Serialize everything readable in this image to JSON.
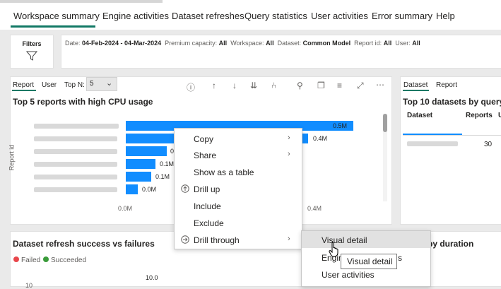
{
  "nav": {
    "tabs": [
      "Workspace summary",
      "Engine activities",
      "Dataset refreshes",
      "Query statistics",
      "User activities",
      "Error summary",
      "Help"
    ]
  },
  "filters": {
    "label": "Filters",
    "items": [
      {
        "key": "Date:",
        "value": "04-Feb-2024 - 04-Mar-2024"
      },
      {
        "key": "Premium capacity:",
        "value": "All"
      },
      {
        "key": "Workspace:",
        "value": "All"
      },
      {
        "key": "Dataset:",
        "value": "Common Model"
      },
      {
        "key": "Report id:",
        "value": "All"
      },
      {
        "key": "User:",
        "value": "All"
      }
    ]
  },
  "left_visual": {
    "subtabs": [
      "Report",
      "User"
    ],
    "topn_label": "Top N:",
    "topn_value": "5",
    "title": "Top 5 reports with high CPU usage",
    "y_axis_label": "Report id",
    "x_ticks": [
      "0.0M",
      "0.4M"
    ],
    "bar_labels": [
      "0.5M",
      "0.4M",
      "0",
      "0.1M",
      "0.1M",
      "0.0M"
    ]
  },
  "chart_data": {
    "type": "bar",
    "title": "Top 5 reports with high CPU usage",
    "ylabel": "Report id",
    "values": [
      0.5,
      0.4,
      0.1,
      0.1,
      0.1,
      0.0
    ]
  },
  "right_visual": {
    "subtabs": [
      "Dataset",
      "Report"
    ],
    "title": "Top 10 datasets by query e",
    "columns": [
      "Dataset",
      "Reports",
      "U"
    ],
    "row_value": "30"
  },
  "bottom_left": {
    "title": "Dataset refresh success vs failures",
    "legend": [
      {
        "label": "Failed",
        "color": "#e8464b"
      },
      {
        "label": "Succeeded",
        "color": "#3a9b3a"
      }
    ],
    "value_label": "10.0",
    "axis_value": "10"
  },
  "bottom_right": {
    "title": "s by duration"
  },
  "context_menu": {
    "items": [
      "Copy",
      "Share",
      "Show as a table",
      "Drill up",
      "Include",
      "Exclude",
      "Drill through"
    ]
  },
  "submenu": {
    "items": [
      "Visual detail",
      "Engin",
      "User activities"
    ],
    "tail": "s"
  },
  "tooltip": {
    "text": "Visual detail"
  },
  "colors": {
    "accent": "#117865",
    "bar": "#118dff",
    "hover": "#e1e1e1"
  }
}
